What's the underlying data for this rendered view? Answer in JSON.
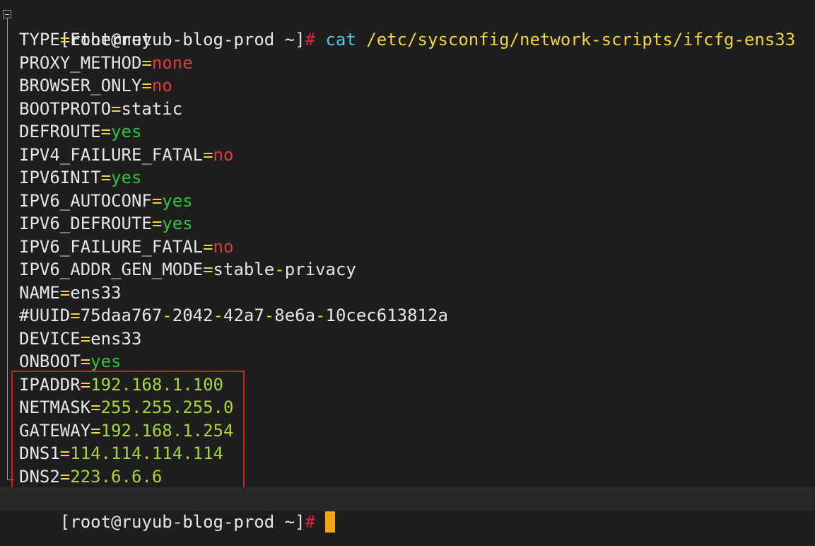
{
  "terminal": {
    "prompt_top": "[root@ruyub-blog-prod ~]",
    "prompt_hash": "#",
    "command": "cat",
    "command_arg": "/etc/sysconfig/network-scripts/ifcfg-ens33",
    "prompt_bottom": "[root@ruyub-blog-prod ~]",
    "eq": "=",
    "dash": "-",
    "lines": {
      "type_key": "TYPE",
      "type_val": "Ethernet",
      "proxy_key": "PROXY_METHOD",
      "proxy_val": "none",
      "browser_key": "BROWSER_ONLY",
      "browser_val": "no",
      "bootproto_key": "BOOTPROTO",
      "bootproto_val": "static",
      "defroute_key": "DEFROUTE",
      "defroute_val": "yes",
      "ipv4ff_key": "IPV4_FAILURE_FATAL",
      "ipv4ff_val": "no",
      "ipv6init_key": "IPV6INIT",
      "ipv6init_val": "yes",
      "ipv6auto_key": "IPV6_AUTOCONF",
      "ipv6auto_val": "yes",
      "ipv6def_key": "IPV6_DEFROUTE",
      "ipv6def_val": "yes",
      "ipv6ff_key": "IPV6_FAILURE_FATAL",
      "ipv6ff_val": "no",
      "ipv6gen_key": "IPV6_ADDR_GEN_MODE",
      "ipv6gen_val_a": "stable",
      "ipv6gen_val_b": "privacy",
      "name_key": "NAME",
      "name_val": "ens33",
      "uuid_key": "#UUID",
      "uuid_p1": "75daa767",
      "uuid_p2": "2042",
      "uuid_p3": "42a7",
      "uuid_p4": "8e6a",
      "uuid_p5": "10cec613812a",
      "device_key": "DEVICE",
      "device_val": "ens33",
      "onboot_key": "ONBOOT",
      "onboot_val": "yes",
      "ipaddr_key": "IPADDR",
      "ipaddr_val": "192.168.1.100",
      "netmask_key": "NETMASK",
      "netmask_val": "255.255.255.0",
      "gateway_key": "GATEWAY",
      "gateway_val": "192.168.1.254",
      "dns1_key": "DNS1",
      "dns1_val": "114.114.114.114",
      "dns2_key": "DNS2",
      "dns2_val": "223.6.6.6"
    }
  },
  "colors": {
    "background": "#1e1e1e",
    "prompt_hash": "#e0263c",
    "command": "#56c6e8",
    "path": "#f0d443",
    "value_red": "#e23a3a",
    "value_green": "#34c13c",
    "value_number": "#a8d63a",
    "highlight_box": "#e0181e",
    "cursor": "#f5a316"
  }
}
